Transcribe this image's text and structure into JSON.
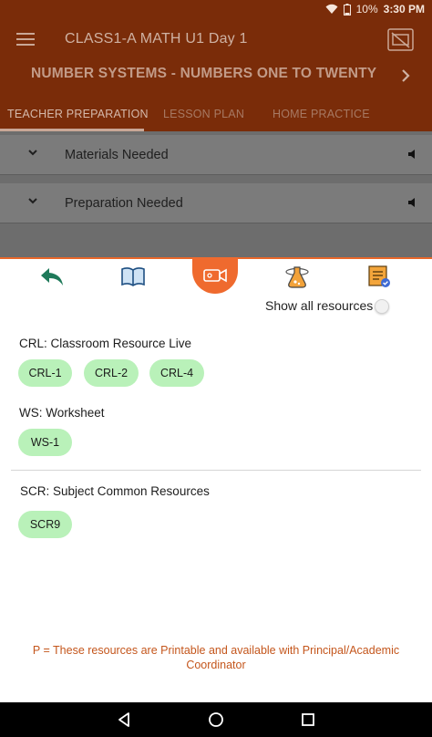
{
  "status": {
    "battery": "10%",
    "time": "3:30 PM"
  },
  "header": {
    "title": "CLASS1-A MATH U1 Day 1",
    "subtitle": "NUMBER SYSTEMS - NUMBERS ONE TO TWENTY",
    "tabs": [
      {
        "label": "TEACHER PREPARATION",
        "active": true
      },
      {
        "label": "LESSON PLAN",
        "active": false
      },
      {
        "label": "HOME PRACTICE",
        "active": false
      }
    ]
  },
  "accordion": [
    {
      "label": "Materials Needed"
    },
    {
      "label": "Preparation Needed"
    }
  ],
  "resources": {
    "toolbar_icons": [
      "back-arrow-icon",
      "book-icon",
      "video-camera-icon",
      "science-flask-icon",
      "checklist-icon"
    ],
    "show_all_label": "Show all resources",
    "show_all_enabled": false,
    "sections": [
      {
        "title": "CRL: Classroom Resource Live",
        "chips": [
          "CRL-1",
          "CRL-2",
          "CRL-4"
        ]
      },
      {
        "title": "WS: Worksheet",
        "chips": [
          "WS-1"
        ]
      },
      {
        "title": "SCR: Subject Common Resources",
        "chips": [
          "SCR9"
        ]
      }
    ],
    "footer_note": "P = These resources are Printable and available with Principal/Academic Coordinator"
  },
  "colors": {
    "app_bar": "#7a2c09",
    "accent": "#ef6a2e",
    "chip": "#b9f1b9",
    "note": "#c4561c"
  }
}
